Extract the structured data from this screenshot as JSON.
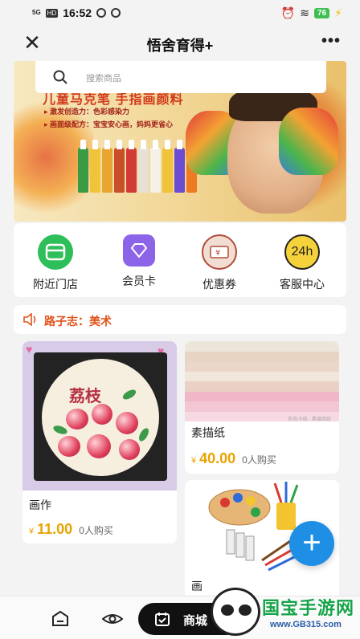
{
  "status_bar": {
    "signal": "5G",
    "hd": "HD",
    "time": "16:52",
    "battery": "76"
  },
  "titlebar": {
    "close_icon": "close-icon",
    "title": "悟舍育得+",
    "more_icon": "more-icon"
  },
  "search": {
    "placeholder": "搜索商品"
  },
  "banner": {
    "headline": "儿童马克笔 手指画颜料",
    "feature_1": "▸ 激发创造力：色彩感染力",
    "feature_2": "▸ 画面级配方：宝宝安心画，妈妈更省心",
    "bottle_colors": [
      "#3a9b44",
      "#f0c33a",
      "#e9a531",
      "#c94f2b",
      "#d23a3a",
      "#e7e0d5",
      "#f5f0e8",
      "#f0c33a",
      "#6a4bd1",
      "#ee7a22"
    ]
  },
  "quick_nav": [
    {
      "label": "附近门店",
      "icon": "store-icon",
      "color": "#2fbf5a"
    },
    {
      "label": "会员卡",
      "icon": "vip-card-icon",
      "color": "#8b64e8"
    },
    {
      "label": "优惠券",
      "icon": "coupon-icon",
      "color": "#f1ddd2"
    },
    {
      "label": "客服中心",
      "icon": "customer-service-24h-icon",
      "color": "#f5d23a",
      "badge": "24h"
    }
  ],
  "notice": {
    "icon": "speaker-icon",
    "text": "路子志：美术"
  },
  "products": [
    {
      "title": "画作",
      "currency": "¥",
      "price": "11.00",
      "sold": "0人购买",
      "art_text": "荔枝"
    },
    {
      "title": "素描纸",
      "currency": "¥",
      "price": "40.00",
      "sold": "0人购买",
      "caption": "彩色卡纸 · 素描用纸",
      "paper_colors": [
        "#ece6da",
        "#e7d4c2",
        "#ead7c9",
        "#f0e6da",
        "#e9d1c6",
        "#efb7c7",
        "#f3c6d4",
        "#f7d9e3"
      ]
    },
    {
      "title": "画"
    }
  ],
  "fab": {
    "label": "+"
  },
  "bottom_bar": {
    "home_icon": "home-icon",
    "eye_icon": "eye-icon",
    "shop_label": "商城"
  },
  "watermark": {
    "text": "国宝手游网",
    "url": "www.GB315.com"
  }
}
